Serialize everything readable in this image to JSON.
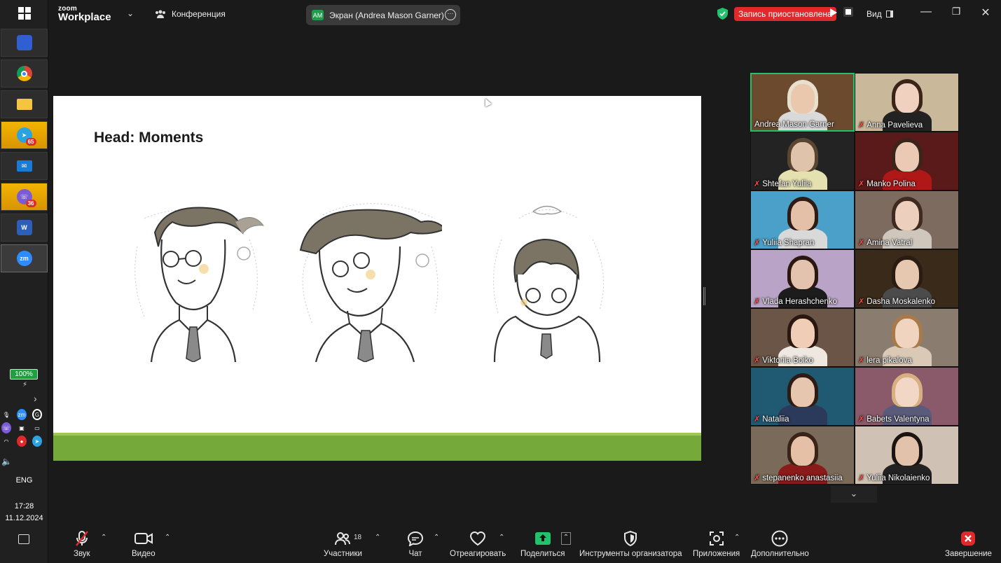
{
  "topbar": {
    "brand_small": "zoom",
    "brand_large": "Workplace",
    "conference_label": "Конференция",
    "screen_share_label": "Экран (Andrea Mason Garner)",
    "screen_share_avatar": "AM",
    "recording_status": "Запись приостановлена",
    "view_label": "Вид"
  },
  "slide": {
    "title": "Head: Moments"
  },
  "gallery": {
    "participants": [
      {
        "name": "Andrea Mason Garner",
        "muted": false,
        "active": true
      },
      {
        "name": "Anna Pavelieva",
        "muted": true
      },
      {
        "name": "Shtefan Yuliia",
        "muted": true
      },
      {
        "name": "Manko Polina",
        "muted": true
      },
      {
        "name": "Yuliia Shapran",
        "muted": true
      },
      {
        "name": "Amina Vatral",
        "muted": true
      },
      {
        "name": "Vlada Herashchenko",
        "muted": true
      },
      {
        "name": "Dasha Moskalenko",
        "muted": true
      },
      {
        "name": "Viktoriia Boiko",
        "muted": true
      },
      {
        "name": "lera pikalova",
        "muted": true
      },
      {
        "name": "Nataliia",
        "muted": true
      },
      {
        "name": "Babets Valentyna",
        "muted": true
      },
      {
        "name": "stepanenko anastasiia",
        "muted": true
      },
      {
        "name": "Yuliia Nikolaienko",
        "muted": true
      }
    ]
  },
  "toolbar": {
    "audio": "Звук",
    "video": "Видео",
    "participants": "Участники",
    "participants_count": "18",
    "chat": "Чат",
    "react": "Отреагировать",
    "share": "Поделиться",
    "host_tools": "Инструменты организатора",
    "apps": "Приложения",
    "more": "Дополнительно",
    "end": "Завершение"
  },
  "taskbar": {
    "battery": "100%",
    "telegram_badge": "65",
    "viber_badge": "36",
    "language": "ENG",
    "time": "17:28",
    "date": "11.12.2024"
  },
  "colors": {
    "accent_green": "#22c16b",
    "recording_red": "#e0292b",
    "slide_bar_green": "#75a93a"
  }
}
